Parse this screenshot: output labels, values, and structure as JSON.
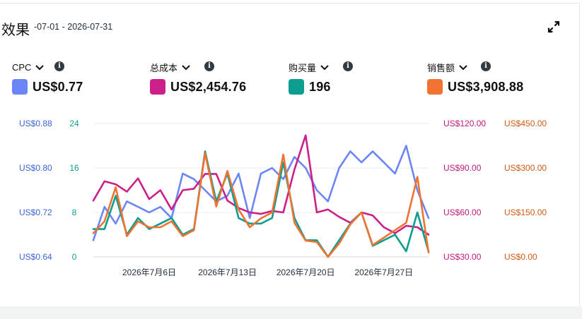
{
  "header": {
    "title": "效果",
    "date_range": "-07-01 - 2026-07-31"
  },
  "icons": {
    "expand": "expand-icon",
    "chevron": "chevron-down-icon",
    "info": "info-icon"
  },
  "info_glyph": "i",
  "metrics": [
    {
      "name": "CPC",
      "value": "US$0.77",
      "color": "#6b86f6"
    },
    {
      "name": "总成本",
      "value": "US$2,454.76",
      "color": "#cc1f8a"
    },
    {
      "name": "购买量",
      "value": "196",
      "color": "#0d9e8f"
    },
    {
      "name": "销售额",
      "value": "US$3,908.88",
      "color": "#f17231"
    }
  ],
  "chart_data": {
    "type": "line",
    "x": [
      "2026-07-01",
      "2026-07-02",
      "2026-07-03",
      "2026-07-04",
      "2026-07-05",
      "2026-07-06",
      "2026-07-07",
      "2026-07-08",
      "2026-07-09",
      "2026-07-10",
      "2026-07-11",
      "2026-07-12",
      "2026-07-13",
      "2026-07-14",
      "2026-07-15",
      "2026-07-16",
      "2026-07-17",
      "2026-07-18",
      "2026-07-19",
      "2026-07-20",
      "2026-07-21",
      "2026-07-22",
      "2026-07-23",
      "2026-07-24",
      "2026-07-25",
      "2026-07-26",
      "2026-07-27",
      "2026-07-28",
      "2026-07-29",
      "2026-07-30",
      "2026-07-31"
    ],
    "x_tick_labels": [
      {
        "date": "2026-07-06",
        "label": "2026年7月6日"
      },
      {
        "date": "2026-07-13",
        "label": "2026年7月13日"
      },
      {
        "date": "2026-07-20",
        "label": "2026年7月20日"
      },
      {
        "date": "2026-07-27",
        "label": "2026年7月27日"
      }
    ],
    "axes": {
      "cpc": {
        "ticks": [
          "US$0.64",
          "US$0.72",
          "US$0.80",
          "US$0.88"
        ],
        "range": [
          0.64,
          0.88
        ],
        "color": "#3d63d8"
      },
      "purchases": {
        "ticks": [
          "0",
          "8",
          "16",
          "24"
        ],
        "range": [
          0,
          24
        ],
        "color": "#0d9e8f"
      },
      "cost": {
        "ticks": [
          "US$30.00",
          "US$60.00",
          "US$90.00",
          "US$120.00"
        ],
        "range": [
          30,
          120
        ],
        "color": "#c2187d"
      },
      "sales": {
        "ticks": [
          "US$0.00",
          "US$150.00",
          "US$300.00",
          "US$450.00"
        ],
        "range": [
          0,
          450
        ],
        "color": "#d15a13"
      }
    },
    "grid": true,
    "series": [
      {
        "name": "CPC",
        "axis": "cpc",
        "color": "#6b86f6",
        "values": [
          0.67,
          0.73,
          0.7,
          0.74,
          0.73,
          0.72,
          0.73,
          0.71,
          0.79,
          0.78,
          0.76,
          0.74,
          0.75,
          0.79,
          0.71,
          0.79,
          0.8,
          0.78,
          0.82,
          0.8,
          0.76,
          0.74,
          0.8,
          0.83,
          0.81,
          0.83,
          0.81,
          0.79,
          0.84,
          0.76,
          0.71
        ]
      },
      {
        "name": "总成本",
        "axis": "cost",
        "color": "#cc1f8a",
        "values": [
          68,
          81,
          79,
          74,
          83,
          69,
          75,
          62,
          75,
          76,
          86,
          86,
          68,
          63,
          60,
          59,
          61,
          60,
          89,
          112,
          60,
          62,
          57,
          53,
          60,
          58,
          50,
          46,
          51,
          50,
          45
        ]
      },
      {
        "name": "购买量",
        "axis": "purchases",
        "color": "#0d9e8f",
        "values": [
          5,
          5,
          11,
          4,
          7,
          5,
          6,
          7,
          4,
          5,
          19,
          10,
          15,
          7,
          6,
          6,
          7,
          17,
          7,
          3,
          3,
          0,
          3,
          6,
          8,
          2,
          3,
          4,
          1,
          8,
          1
        ]
      },
      {
        "name": "销售额",
        "axis": "sales",
        "color": "#f17231",
        "values": [
          80,
          120,
          235,
          70,
          120,
          100,
          100,
          120,
          70,
          90,
          350,
          170,
          290,
          160,
          100,
          130,
          150,
          345,
          115,
          55,
          50,
          0,
          45,
          110,
          150,
          40,
          65,
          90,
          115,
          270,
          15
        ]
      }
    ]
  }
}
